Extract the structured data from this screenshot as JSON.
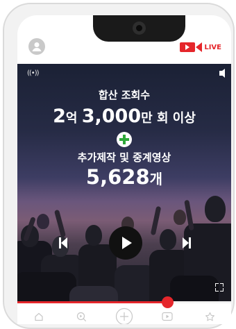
{
  "header": {
    "avatar_icon": "user-avatar-icon",
    "live_label": "LIVE",
    "live_color": "#e5262b"
  },
  "video": {
    "overlay": {
      "line1": "합산 조회수",
      "line2_big1": "2",
      "line2_small1": "억 ",
      "line2_big2": "3,000",
      "line2_small2": "만 회 이상",
      "line3": "추가제작 및 중계영상",
      "line4_big": "5,628",
      "line4_small": "개"
    },
    "broadcast_icon": "broadcast-icon",
    "speaker_icon": "speaker-icon",
    "progress_percent": 70
  },
  "controls": {
    "play_icon": "play-icon",
    "prev_icon": "skip-previous-icon",
    "next_icon": "skip-next-icon",
    "fullscreen_icon": "fullscreen-icon"
  },
  "bottom_nav": [
    {
      "icon": "home-icon"
    },
    {
      "icon": "search-icon"
    },
    {
      "icon": "add-icon"
    },
    {
      "icon": "play-box-icon"
    },
    {
      "icon": "star-icon"
    }
  ]
}
